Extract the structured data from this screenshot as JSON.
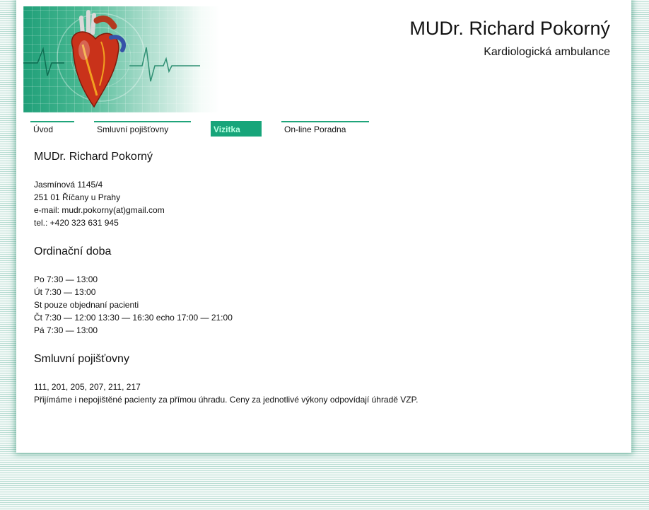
{
  "header": {
    "title": "MUDr. Richard Pokorný",
    "subtitle": "Kardiologická ambulance"
  },
  "nav": [
    {
      "label": "Úvod",
      "active": false
    },
    {
      "label": "Smluvní pojišťovny",
      "active": false
    },
    {
      "label": "Vizitka",
      "active": true
    },
    {
      "label": "On-line Poradna",
      "active": false
    }
  ],
  "contact": {
    "heading": "MUDr. Richard Pokorný",
    "lines": [
      "Jasmínová 1145/4",
      "251 01 Říčany u Prahy",
      "e-mail: mudr.pokorny(at)gmail.com",
      "tel.: +420 323 631 945"
    ]
  },
  "hours": {
    "heading": "Ordinační doba",
    "lines": [
      "Po 7:30 — 13:00",
      "Út 7:30 — 13:00",
      "St pouze objednaní pacienti",
      "Čt 7:30 — 12:00 13:30 — 16:30 echo 17:00 — 21:00",
      "Pá 7:30 — 13:00"
    ]
  },
  "insurance": {
    "heading": "Smluvní pojišťovny",
    "lines": [
      "111, 201, 205, 207, 211, 217",
      "Přijímáme i nepojištěné pacienty za přímou úhradu. Ceny za jednotlivé výkony odpovídají úhradě VZP."
    ]
  },
  "colors": {
    "accent": "#17a57a",
    "active_text": "#b8ffe2",
    "text": "#111111"
  },
  "icons": {
    "banner": "heart-ecg-banner"
  }
}
